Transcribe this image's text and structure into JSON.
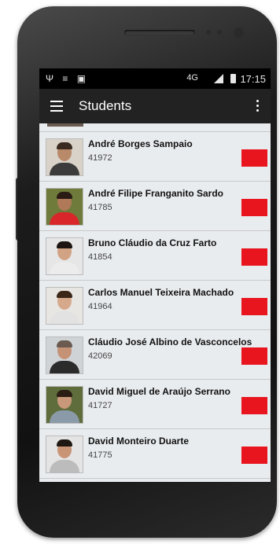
{
  "status_bar": {
    "left_icons": "Ψ ≡ ▣",
    "network": "4G",
    "time": "17:15"
  },
  "app_bar": {
    "title": "Students"
  },
  "students": [
    {
      "name": "André Borges Sampaio",
      "number": "41972",
      "photo_bg": "#d9d2c8",
      "shirt": "#3c3c3c",
      "skin": "#b88a6a",
      "hair": "#3a2a20"
    },
    {
      "name": "André Filipe Franganito Sardo",
      "number": "41785",
      "photo_bg": "#6f7b3a",
      "shirt": "#d8262a",
      "skin": "#b07a58",
      "hair": "#2a1c14"
    },
    {
      "name": "Bruno Cláudio da Cruz Farto",
      "number": "41854",
      "photo_bg": "#e6e6e6",
      "shirt": "#ececec",
      "skin": "#d2a284",
      "hair": "#1c1410"
    },
    {
      "name": "Carlos Manuel Teixeira Machado",
      "number": "41964",
      "photo_bg": "#e8e6e2",
      "shirt": "#e2e2e2",
      "skin": "#d6a98c",
      "hair": "#3b2718"
    },
    {
      "name": "Cláudio José Albino de Vasconcelos",
      "number": "42069",
      "photo_bg": "#cfd3d6",
      "shirt": "#2b2b2b",
      "skin": "#c59276",
      "hair": "#6a5a50"
    },
    {
      "name": "David Miguel de Araújo Serrano",
      "number": "41727",
      "photo_bg": "#5f6d3c",
      "shirt": "#8a9aa8",
      "skin": "#c9987a",
      "hair": "#2a1d14"
    },
    {
      "name": "David Monteiro Duarte",
      "number": "41775",
      "photo_bg": "#e4e4e4",
      "shirt": "#bcbcbc",
      "skin": "#c99476",
      "hair": "#1f1812"
    }
  ],
  "colors": {
    "badge": "#e8141e",
    "row_bg": "#e9ecef",
    "app_bar": "#222222"
  }
}
